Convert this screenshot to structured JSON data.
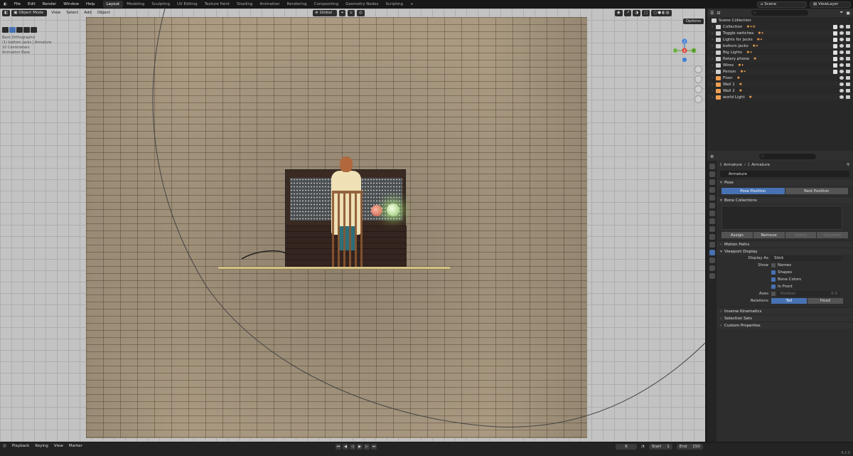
{
  "menu": {
    "items": [
      "File",
      "Edit",
      "Render",
      "Window",
      "Help"
    ]
  },
  "workspaces": {
    "tabs": [
      "Layout",
      "Modeling",
      "Sculpting",
      "UV Editing",
      "Texture Paint",
      "Shading",
      "Animation",
      "Rendering",
      "Compositing",
      "Geometry Nodes",
      "Scripting"
    ],
    "active": "Layout",
    "add": "+"
  },
  "topright": {
    "scene": "Scene",
    "view_layer": "ViewLayer"
  },
  "viewport": {
    "mode": "Object Mode",
    "menus": [
      "View",
      "Select",
      "Add",
      "Object"
    ],
    "transform": "Global",
    "options": "Options",
    "overlay_lines": [
      "Back Orthographic",
      "(1) bottom Jacks | Armature",
      "10 Centimeters",
      "Animation Base"
    ],
    "gizmo": {
      "x": "X",
      "y": "Y",
      "z": "Z"
    }
  },
  "outliner": {
    "search_placeholder": "",
    "root": "Scene Collection",
    "rows": [
      {
        "name": "Collection",
        "extra": "✱✦⚙"
      },
      {
        "name": "Toggle switches",
        "extra": "✱✦"
      },
      {
        "name": "Lights for Jacks",
        "extra": "✱✦"
      },
      {
        "name": "bottom Jacks",
        "extra": "✱✦"
      },
      {
        "name": "Big Lights",
        "extra": "✱✦"
      },
      {
        "name": "Rotary phone",
        "extra": "✱"
      },
      {
        "name": "Wires",
        "extra": "✱✦"
      },
      {
        "name": "Person",
        "extra": "✱✦"
      },
      {
        "name": "Floor",
        "extra": "✱"
      },
      {
        "name": "Wall 1",
        "extra": "✱"
      },
      {
        "name": "Wall 2",
        "extra": "✱"
      },
      {
        "name": "world Light",
        "extra": "✱"
      }
    ]
  },
  "properties": {
    "search_placeholder": "",
    "breadcrumb": [
      "Armature",
      "Armature"
    ],
    "data_name": "Armature",
    "pose": {
      "title": "Pose",
      "btn_pose": "Pose Position",
      "btn_rest": "Rest Position"
    },
    "bone_collections": {
      "title": "Bone Collections",
      "assign": "Assign",
      "remove": "Remove",
      "select": "Select",
      "deselect": "Deselect"
    },
    "motion_paths": "Motion Paths",
    "viewport_display": {
      "title": "Viewport Display",
      "display_as_label": "Display As",
      "display_as_value": "Stick",
      "show_label": "Show",
      "names": "Names",
      "shapes": "Shapes",
      "bone_colors": "Bone Colors",
      "in_front": "In Front",
      "axes_label": "Axes",
      "axes_pos": "Position",
      "axes_val": "0.0",
      "relations_label": "Relations",
      "tail": "Tail",
      "head": "Head"
    },
    "inverse_kinematics": "Inverse Kinematics",
    "selection_sets": "Selection Sets",
    "custom_properties": "Custom Properties"
  },
  "timeline": {
    "menus": [
      "Playback",
      "Keying",
      "View",
      "Marker"
    ],
    "current_frame": "6",
    "start_label": "Start",
    "start": "1",
    "end_label": "End",
    "end": "150"
  },
  "status": {
    "version": "4.2.0"
  },
  "colors": {
    "accent": "#4772b3",
    "orange": "#f0a050"
  }
}
